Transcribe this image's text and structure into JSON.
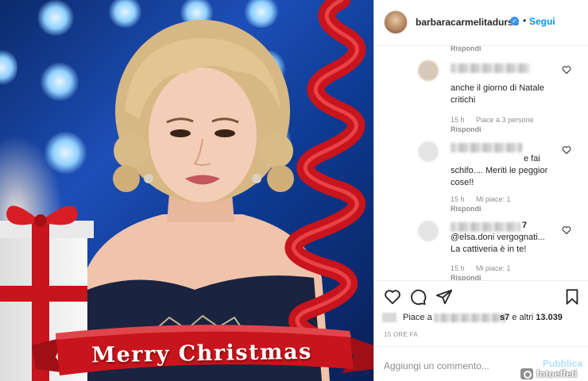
{
  "post": {
    "photo_caption_text": "Merry Christmas"
  },
  "header": {
    "username": "barbaracarmelitadurso",
    "separator": "•",
    "follow_label": "Segui"
  },
  "comments": {
    "top_reply_label": "Rispondi",
    "items": [
      {
        "text": "anche il giorno di Natale critichi",
        "time": "15 h",
        "likes": "Piace a 3 persone",
        "reply": "Rispondi"
      },
      {
        "text": "e fai schifo.... Meriti le peggior cose!!",
        "time": "15 h",
        "likes": "Mi piace: 1",
        "reply": "Rispondi"
      },
      {
        "name_suffix": "7",
        "text": "@elsa.doni vergognati... La cattiveria è in te!",
        "time": "15 h",
        "likes": "Mi piace: 1",
        "reply": "Rispondi"
      }
    ]
  },
  "likes": {
    "prefix": "Piace a",
    "suffix_char": "s7",
    "rest": "e altri",
    "count": "13.039"
  },
  "timestamp": "15 ORE FA",
  "add_comment": {
    "placeholder": "Aggiungi un commento...",
    "publish_label": "Pubblica"
  },
  "watermark": {
    "text": "fotoeffeti"
  },
  "icons": {
    "like": "heart-icon",
    "comment": "comment-icon",
    "share": "send-icon",
    "save": "bookmark-icon",
    "verified": "verified-badge-icon"
  },
  "colors": {
    "link_blue": "#0095f6",
    "verified_blue": "#3897f0",
    "muted_text": "#8e8e8e",
    "ribbon_red": "#c8141c"
  }
}
